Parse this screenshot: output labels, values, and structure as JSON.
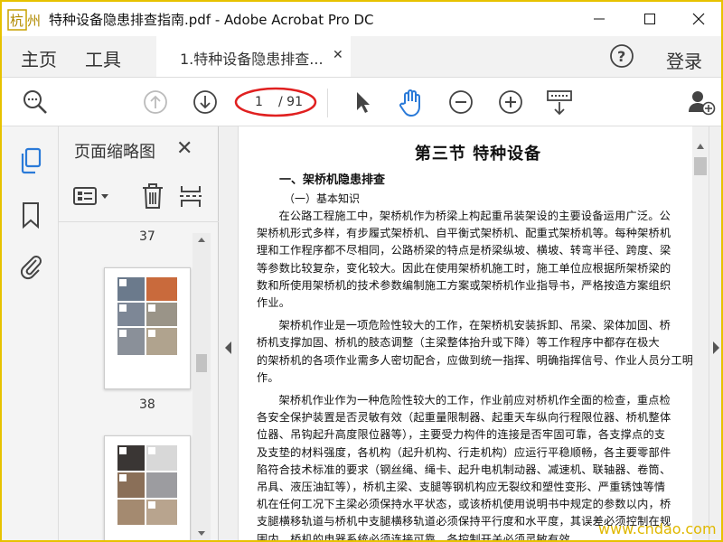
{
  "window": {
    "title": "特种设备隐患排查指南.pdf - Adobe Acrobat Pro DC",
    "logo_text": "杭州"
  },
  "tabs": {
    "home": "主页",
    "tools": "工具",
    "document": "1.特种设备隐患排查...",
    "login": "登录"
  },
  "toolbar": {
    "current_page": "1",
    "total_pages": "/ 91"
  },
  "thumbnails": {
    "title": "页面缩略图",
    "page_labels": [
      "37",
      "38"
    ]
  },
  "document": {
    "section_title": "第三节  特种设备",
    "heading1": "一、架桥机隐患排查",
    "heading2": "（一）基本知识",
    "lines": [
      "      在公路工程施工中，架桥机作为桥梁上构起重吊装架设的主要设备运用广泛。公",
      "架桥机形式多样，有步履式架桥机、自平衡式架桥机、配重式架桥机等。每种架桥机",
      "理和工作程序都不尽相同，公路桥梁的特点是桥梁纵坡、横坡、转弯半径、跨度、梁",
      "等参数比较复杂，变化较大。因此在使用架桥机施工时，施工单位应根据所架桥梁的",
      "数和所使用架桥机的技术参数编制施工方案或架桥机作业指导书，严格按造方案组织",
      "作业。",
      "      架桥机作业是一项危险性较大的工作，在架桥机安装拆卸、吊梁、梁体加固、桥",
      "桥机支撑加固、桥机的肢态调整（主梁整体抬升或下降）等工作程序中都存在极大",
      "的架桥机的各项作业需多人密切配合，应做到统一指挥、明确指挥信号、作业人员分工明",
      "作。",
      "      架桥机作业作为一种危险性较大的工作，作业前应对桥机作全面的检查，重点检",
      "各安全保护装置是否灵敏有效（起重量限制器、起重天车纵向行程限位器、桥机整体",
      "位器、吊钩起升高度限位器等），主要受力构件的连接是否牢固可靠，各支撑点的支",
      "及支垫的材料强度，各机构（起升机构、行走机构）应运行平稳顺畅，各主要零部件",
      "陷符合技术标准的要求（钢丝绳、绳卡、起升电机制动器、减速机、联轴器、卷筒、",
      "吊具、液压油缸等），桥机主梁、支腿等钢机构应无裂纹和塑性变形、严重锈蚀等情",
      "机在任何工况下主梁必须保持水平状态，或该桥机使用说明书中规定的参数以内，桥",
      "支腿横移轨道与桥机中支腿横移轨道必须保持平行度和水平度，其误差必须控制在规",
      "围内。桥机的电器系统必须连接可靠，各控制开关必须灵敏有效。"
    ]
  },
  "watermark": "www.cndao.com",
  "colors": {
    "accent_blue": "#2a7ad8",
    "annotation_red": "#e02020",
    "frame_yellow": "#e7c200"
  }
}
